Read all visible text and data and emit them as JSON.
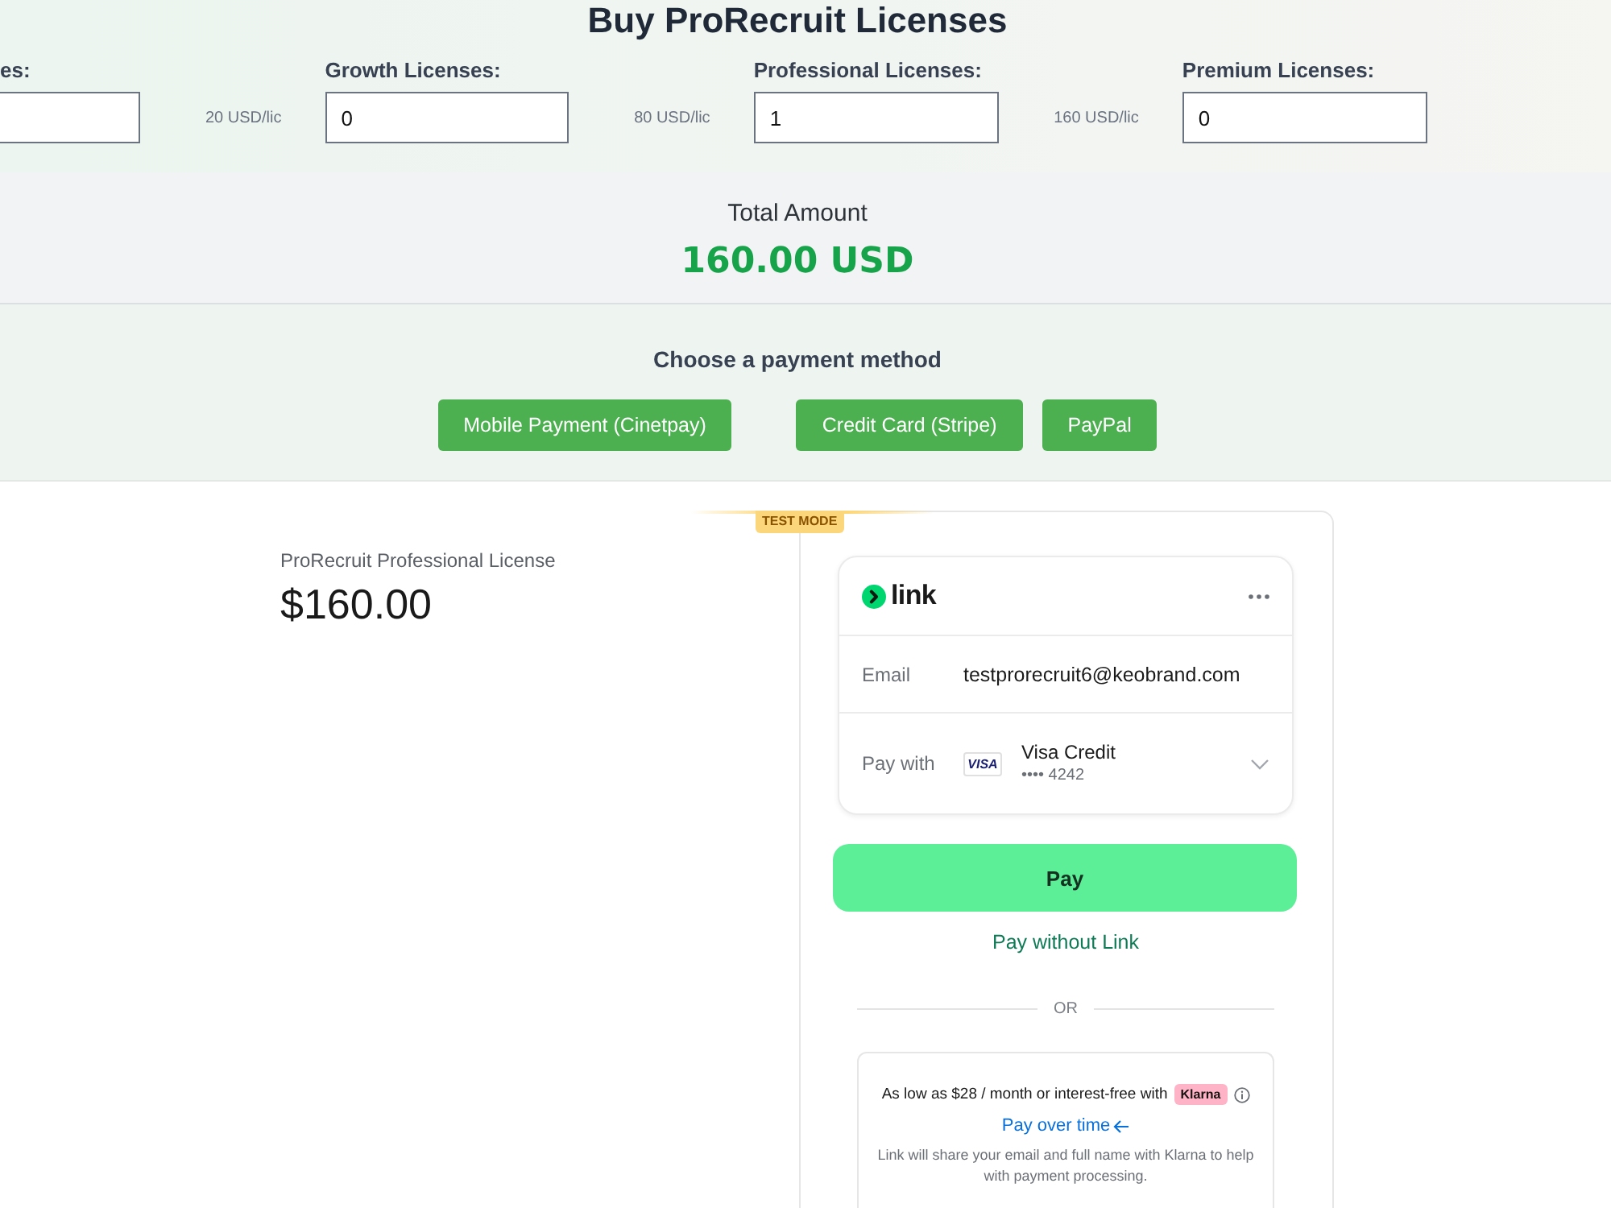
{
  "page": {
    "title": "Buy ProRecruit Licenses"
  },
  "licenses": [
    {
      "label": "es:",
      "price": "20 USD/lic"
    },
    {
      "label": "Growth Licenses:",
      "value": "0",
      "price": "80 USD/lic"
    },
    {
      "label": "Professional Licenses:",
      "value": "1",
      "price": "160 USD/lic"
    },
    {
      "label": "Premium Licenses:",
      "value": "0"
    }
  ],
  "total": {
    "label": "Total Amount",
    "amount": "160.00 USD"
  },
  "payment_methods": {
    "heading": "Choose a payment method",
    "buttons": [
      "Mobile Payment (Cinetpay)",
      "Credit Card (Stripe)",
      "PayPal"
    ]
  },
  "checkout": {
    "product": "ProRecruit Professional License",
    "price": "$160.00",
    "test_badge": "TEST MODE",
    "link_card": {
      "logo_text": "link",
      "email_label": "Email",
      "email": "testprorecruit6@keobrand.com",
      "pay_with_label": "Pay with",
      "card_brand": "VISA",
      "card_name": "Visa Credit",
      "card_number": "•••• 4242"
    },
    "pay_button": "Pay",
    "pay_without_link": "Pay without Link",
    "divider": "OR",
    "klarna": {
      "text": "As low as $28 / month or interest-free with",
      "badge": "Klarna",
      "link": "Pay over time",
      "note": "Link will share your email and full name with Klarna to help with payment processing."
    }
  }
}
